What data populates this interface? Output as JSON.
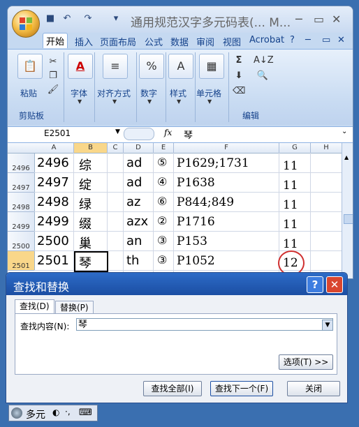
{
  "window": {
    "title": "通用规范汉字多元码表(... M...",
    "ribbon_tabs": [
      "开始",
      "插入",
      "页面布局",
      "公式",
      "数据",
      "审阅",
      "视图",
      "Acrobat"
    ]
  },
  "ribbon": {
    "paste_label": "粘贴",
    "clipboard_group": "剪贴板",
    "font_label": "字体",
    "align_label": "对齐方式",
    "number_label": "数字",
    "number_icon": "%",
    "style_label": "样式",
    "cells_label": "单元格",
    "edit_group": "编辑",
    "sum_icon": "Σ",
    "sort_icon": "A↓Z"
  },
  "formula_bar": {
    "name_box": "E2501",
    "fx": "fx",
    "value": "琴"
  },
  "sheet": {
    "columns": [
      "A",
      "B",
      "C",
      "D",
      "E",
      "F",
      "G",
      "H"
    ],
    "rows": [
      {
        "num": "2496",
        "a": "2496",
        "b": "综",
        "d": "ad",
        "e": "⑤",
        "f": "P1629;1731",
        "g": "11"
      },
      {
        "num": "2497",
        "a": "2497",
        "b": "绽",
        "d": "ad",
        "e": "④",
        "f": "P1638",
        "g": "11"
      },
      {
        "num": "2498",
        "a": "2498",
        "b": "绿",
        "d": "az",
        "e": "⑥",
        "f": "P844;849",
        "g": "11"
      },
      {
        "num": "2499",
        "a": "2499",
        "b": "缀",
        "d": "azx",
        "e": "②",
        "f": "P1716",
        "g": "11"
      },
      {
        "num": "2500",
        "a": "2500",
        "b": "巢",
        "d": "an",
        "e": "③",
        "f": "P153",
        "g": "11"
      },
      {
        "num": "2501",
        "a": "2501",
        "b": "琴",
        "d": "th",
        "e": "③",
        "f": "P1052",
        "g": "12"
      }
    ]
  },
  "dialog": {
    "title": "查找和替换",
    "help": "?",
    "close": "✕",
    "tab_find": "查找(D)",
    "tab_replace": "替换(P)",
    "find_label": "查找内容(N):",
    "find_value": "琴",
    "options_btn": "选项(T) >>",
    "find_all_btn": "查找全部(I)",
    "find_next_btn": "查找下一个(F)",
    "close_btn": "关闭"
  },
  "langbar": {
    "ime_label": "多元"
  },
  "colors": {
    "accent": "#1b4ea3",
    "circle": "#d03030",
    "selected_header": "#f9d78a"
  }
}
